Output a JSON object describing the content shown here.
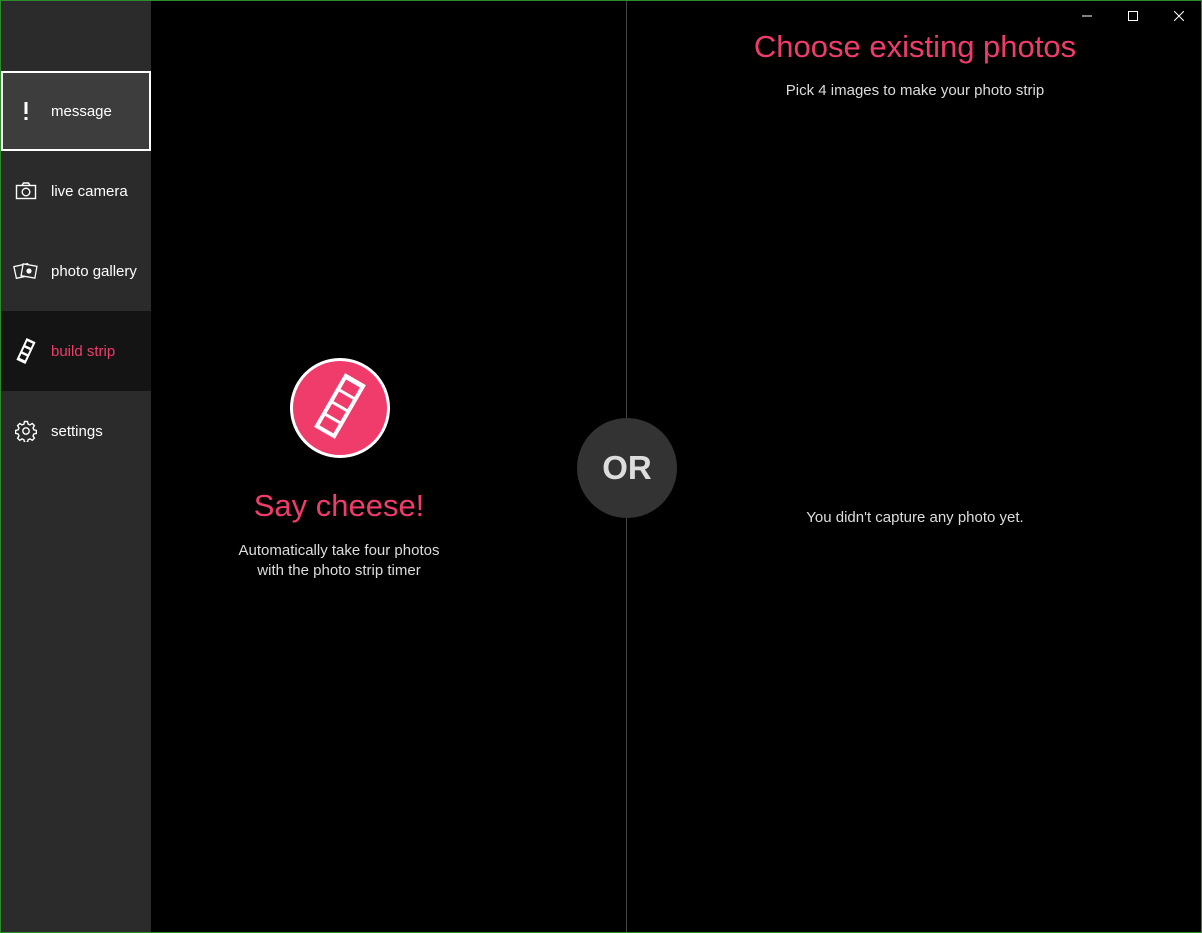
{
  "window": {
    "controls": {
      "minimize": "minimize-icon",
      "maximize": "maximize-icon",
      "close": "close-icon"
    }
  },
  "sidebar": {
    "items": [
      {
        "label": "message",
        "icon": "exclamation-icon",
        "state": "focused"
      },
      {
        "label": "live camera",
        "icon": "camera-icon",
        "state": "normal"
      },
      {
        "label": "photo gallery",
        "icon": "gallery-icon",
        "state": "normal"
      },
      {
        "label": "build strip",
        "icon": "film-strip-icon",
        "state": "active"
      },
      {
        "label": "settings",
        "icon": "gear-icon",
        "state": "normal"
      }
    ]
  },
  "left_panel": {
    "title": "Say cheese!",
    "description_line1": "Automatically take four photos",
    "description_line2": "with the photo strip timer",
    "button_icon": "film-strip-icon"
  },
  "divider": {
    "or_label": "OR"
  },
  "right_panel": {
    "title": "Choose existing photos",
    "subtitle": "Pick 4 images to make your photo strip",
    "empty_message": "You didn't capture any photo yet."
  },
  "colors": {
    "accent": "#f03c6a",
    "sidebar_bg": "#2b2b2b",
    "focused_bg": "#3d3d3d",
    "active_bg": "#141414",
    "background": "#000000"
  }
}
